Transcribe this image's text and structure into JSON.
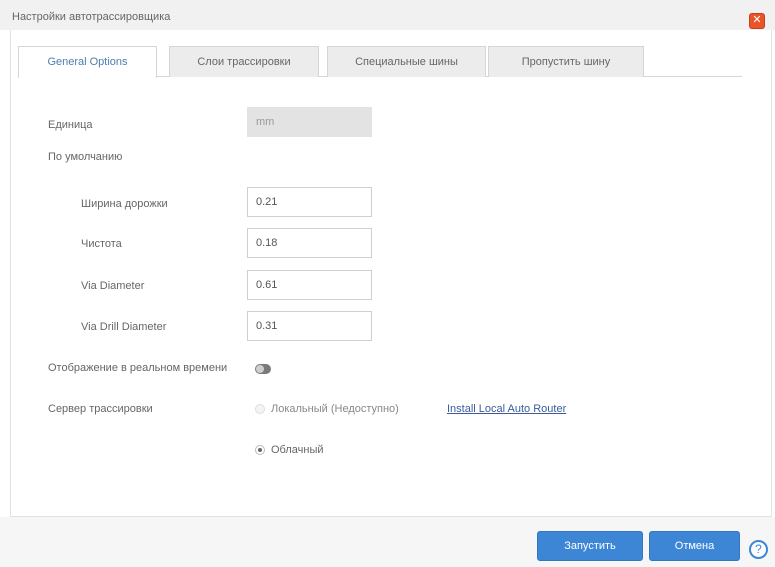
{
  "dialog": {
    "title": "Настройки автотрассировщика",
    "close_icon": "close-icon",
    "close_glyph": "✕"
  },
  "tabs": [
    {
      "label": "General Options",
      "active": true
    },
    {
      "label": "Слои трассировки",
      "active": false
    },
    {
      "label": "Специальные шины",
      "active": false
    },
    {
      "label": "Пропустить шину",
      "active": false
    }
  ],
  "general": {
    "unit_label": "Единица",
    "unit_value": "mm",
    "defaults_label": "По умолчанию",
    "track_width_label": "Ширина дорожки",
    "track_width_value": "0.21",
    "clearance_label": "Чистота",
    "clearance_value": "0.18",
    "via_diameter_label": "Via Diameter",
    "via_diameter_value": "0.61",
    "via_drill_label": "Via Drill Diameter",
    "via_drill_value": "0.31",
    "realtime_label": "Отображение в реальном времени",
    "server_label": "Сервер трассировки",
    "local_option": "Локальный (Недоступно)",
    "install_link": "Install Local Auto Router",
    "cloud_option": "Облачный"
  },
  "footer": {
    "run_button": "Запустить",
    "cancel_button": "Отмена",
    "help_glyph": "?"
  },
  "colors": {
    "accent": "#3d86d6",
    "close": "#e9552b",
    "link": "#3a5b9c"
  }
}
